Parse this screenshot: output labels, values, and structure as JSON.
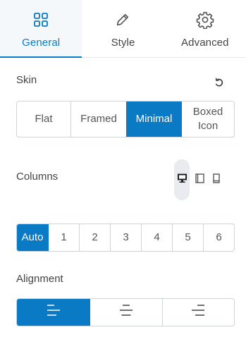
{
  "tabs": [
    {
      "label": "General",
      "icon": "grid-icon",
      "active": true
    },
    {
      "label": "Style",
      "icon": "pencil-icon",
      "active": false
    },
    {
      "label": "Advanced",
      "icon": "gear-icon",
      "active": false
    }
  ],
  "skin": {
    "label": "Skin",
    "options": [
      "Flat",
      "Framed",
      "Minimal",
      "Boxed Icon"
    ],
    "selected": "Minimal"
  },
  "columns": {
    "label": "Columns",
    "devices": [
      {
        "name": "desktop-icon",
        "selected": true
      },
      {
        "name": "tablet-icon",
        "selected": false
      },
      {
        "name": "mobile-icon",
        "selected": false
      }
    ],
    "options": [
      "Auto",
      "1",
      "2",
      "3",
      "4",
      "5",
      "6"
    ],
    "selected": "Auto"
  },
  "alignment": {
    "label": "Alignment",
    "options": [
      "align-left-icon",
      "align-center-icon",
      "align-right-icon"
    ],
    "selected": "align-left-icon"
  },
  "colors": {
    "accent": "#0b7ac4",
    "border": "#cfd4d9",
    "text": "#444444"
  }
}
